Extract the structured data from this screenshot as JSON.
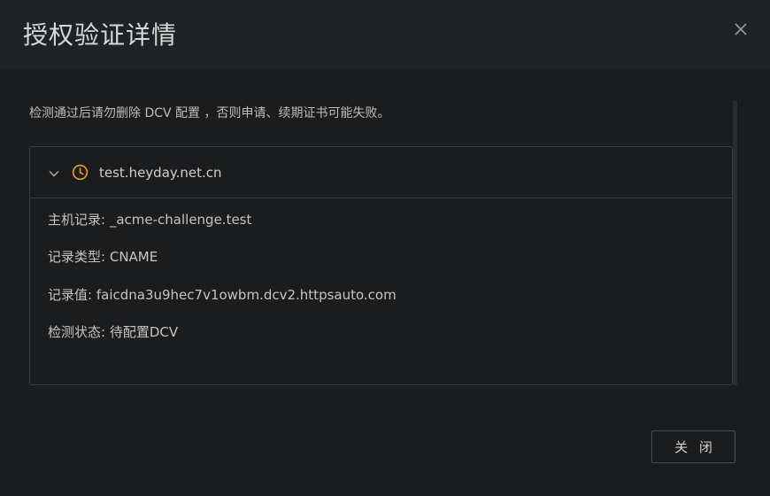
{
  "dialog": {
    "title": "授权验证详情",
    "notice": "检测通过后请勿删除 DCV 配置 ，否则申请、续期证书可能失败。",
    "close_button_label": "关 闭"
  },
  "panel": {
    "domain": "test.heyday.net.cn",
    "status_icon": "clock-icon",
    "status_color": "#f0a020",
    "rows": [
      {
        "label": "主机记录:",
        "value": "_acme-challenge.test"
      },
      {
        "label": "记录类型:",
        "value": "CNAME"
      },
      {
        "label": "记录值:",
        "value": "faicdna3u9hec7v1owbm.dcv2.httpsauto.com"
      },
      {
        "label": "检测状态:",
        "value": "待配置DCV"
      }
    ]
  }
}
